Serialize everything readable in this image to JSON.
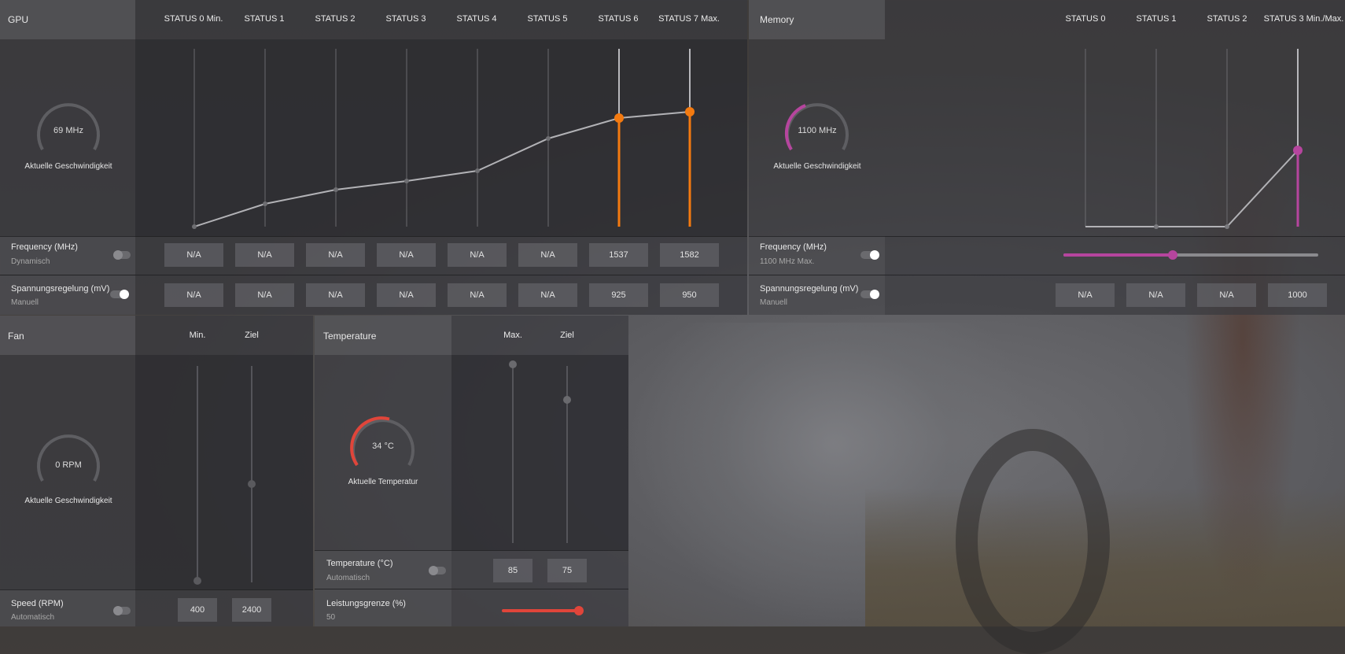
{
  "gpu": {
    "title": "GPU",
    "states": [
      "STATUS 0 Min.",
      "STATUS 1",
      "STATUS 2",
      "STATUS 3",
      "STATUS 4",
      "STATUS 5",
      "STATUS 6",
      "STATUS 7 Max."
    ],
    "gauge": {
      "value": "69 MHz",
      "caption": "Aktuelle Geschwindigkeit"
    },
    "frequency": {
      "label": "Frequency (MHz)",
      "mode": "Dynamisch",
      "values": [
        "N/A",
        "N/A",
        "N/A",
        "N/A",
        "N/A",
        "N/A",
        "1537",
        "1582"
      ]
    },
    "voltage": {
      "label": "Spannungsregelung (mV)",
      "mode": "Manuell",
      "values": [
        "N/A",
        "N/A",
        "N/A",
        "N/A",
        "N/A",
        "N/A",
        "925",
        "950"
      ]
    },
    "active_color": "#f47a10"
  },
  "memory": {
    "title": "Memory",
    "states": [
      "STATUS 0",
      "STATUS 1",
      "STATUS 2",
      "STATUS 3 Min./Max."
    ],
    "gauge": {
      "value": "1100 MHz",
      "caption": "Aktuelle Geschwindigkeit"
    },
    "frequency": {
      "label": "Frequency (MHz)",
      "mode": "1100 MHz Max."
    },
    "voltage": {
      "label": "Spannungsregelung (mV)",
      "mode": "Manuell",
      "values": [
        "N/A",
        "N/A",
        "N/A",
        "1000"
      ]
    },
    "active_color": "#b6459e"
  },
  "fan": {
    "title": "Fan",
    "cols": [
      "Min.",
      "Ziel"
    ],
    "gauge": {
      "value": "0 RPM",
      "caption": "Aktuelle Geschwindigkeit"
    },
    "speed": {
      "label": "Speed (RPM)",
      "mode": "Automatisch",
      "values": [
        "400",
        "2400"
      ]
    }
  },
  "temperature": {
    "title": "Temperature",
    "cols": [
      "Max.",
      "Ziel"
    ],
    "gauge": {
      "value": "34 °C",
      "caption": "Aktuelle Temperatur"
    },
    "temp": {
      "label": "Temperature (°C)",
      "mode": "Automatisch",
      "values": [
        "85",
        "75"
      ]
    },
    "power": {
      "label": "Leistungsgrenze (%)",
      "value": "50"
    },
    "active_color": "#e0453a"
  }
}
